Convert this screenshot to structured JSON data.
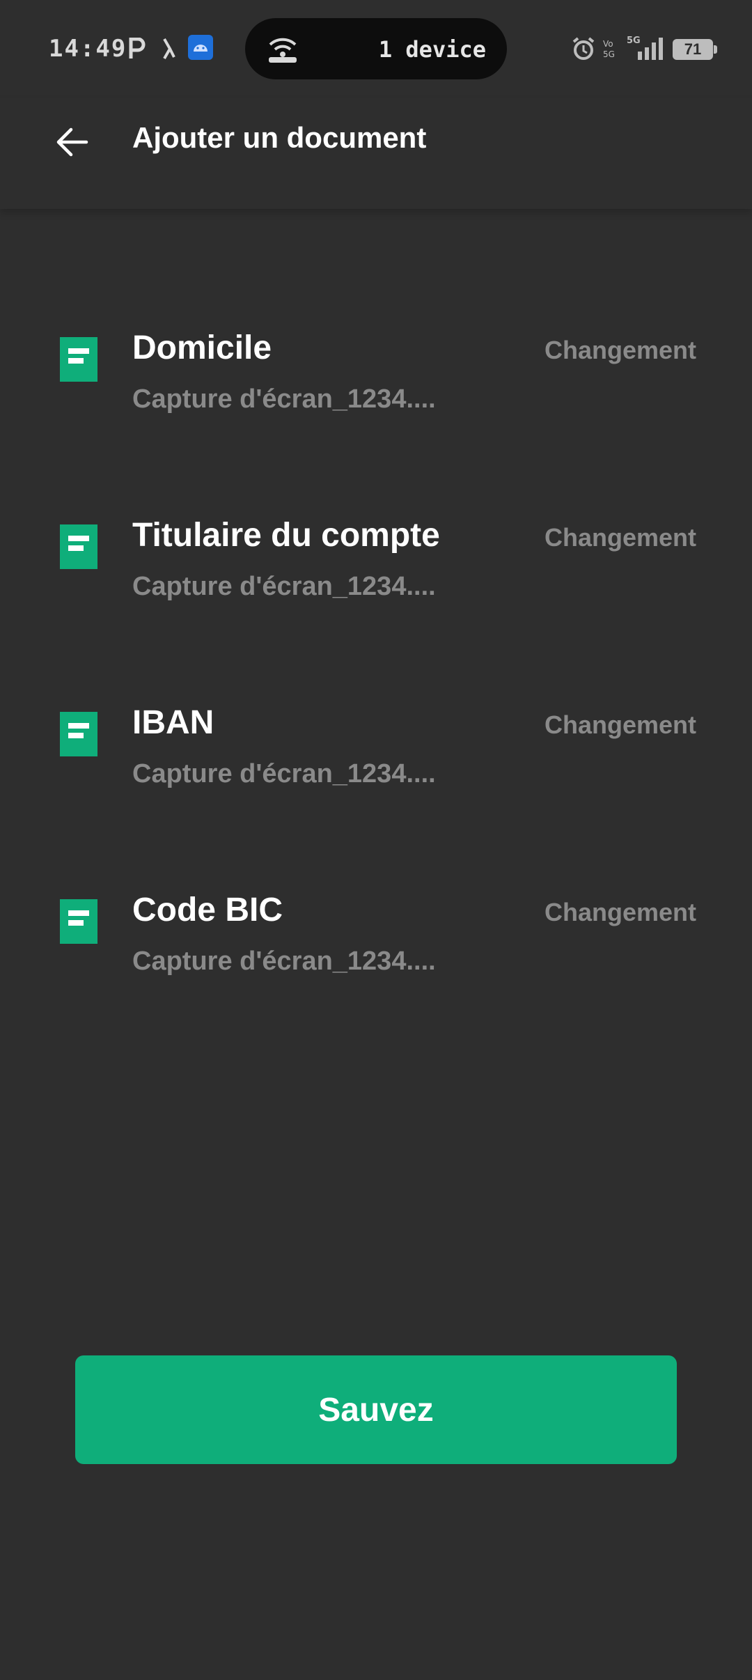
{
  "status_bar": {
    "time": "14:49",
    "pill_text": "1 device",
    "battery": "71",
    "network": "5G"
  },
  "header": {
    "title": "Ajouter un document"
  },
  "documents": [
    {
      "title": "Domicile",
      "file": "Capture d'écran_1234....",
      "action": "Changement"
    },
    {
      "title": "Titulaire du compte",
      "file": "Capture d'écran_1234....",
      "action": "Changement"
    },
    {
      "title": "IBAN",
      "file": "Capture d'écran_1234....",
      "action": "Changement"
    },
    {
      "title": "Code BIC",
      "file": "Capture d'écran_1234....",
      "action": "Changement"
    }
  ],
  "save_button": {
    "label": "Sauvez"
  },
  "colors": {
    "background": "#2e2e2e",
    "accent": "#0fae7a",
    "muted_text": "#8a8a8a"
  }
}
